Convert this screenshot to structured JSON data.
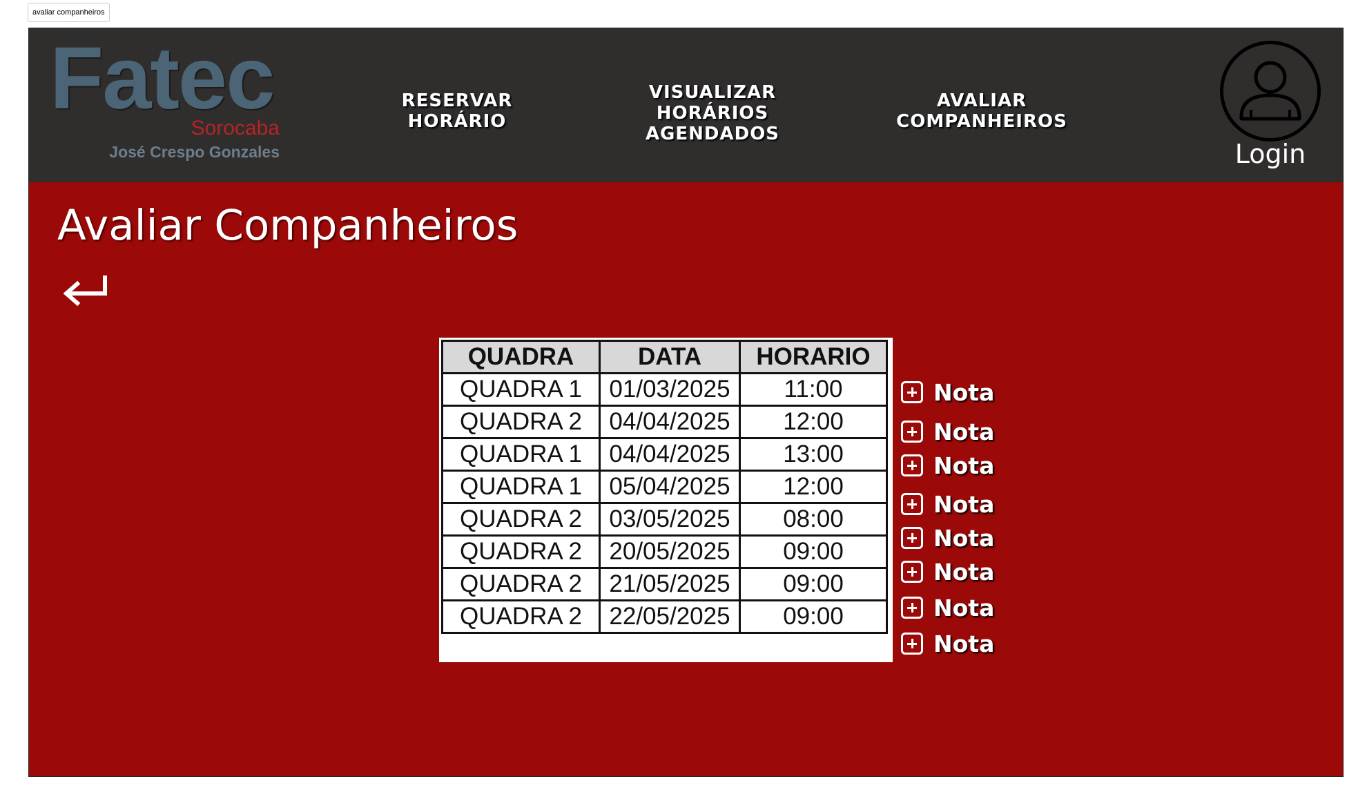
{
  "browser": {
    "tab_label": "avaliar companheiros"
  },
  "header": {
    "logo": {
      "main": "Fatec",
      "city": "Sorocaba",
      "subtitle": "José Crespo Gonzales"
    },
    "nav": [
      {
        "label": "RESERVAR\nHORÁRIO"
      },
      {
        "label": "VISUALIZAR\nHORÁRIOS\nAGENDADOS"
      },
      {
        "label": "AVALIAR\nCOMPANHEIROS"
      }
    ],
    "login": {
      "label": "Login",
      "icon": "user-icon"
    }
  },
  "main": {
    "title": "Avaliar Companheiros",
    "back_icon": "return-arrow-icon",
    "table": {
      "headers": [
        "QUADRA",
        "DATA",
        "HORARIO"
      ],
      "rows": [
        [
          "QUADRA 1",
          "01/03/2025",
          "11:00"
        ],
        [
          "QUADRA 2",
          "04/04/2025",
          "12:00"
        ],
        [
          "QUADRA 1",
          "04/04/2025",
          "13:00"
        ],
        [
          "QUADRA 1",
          "05/04/2025",
          "12:00"
        ],
        [
          "QUADRA 2",
          "03/05/2025",
          "08:00"
        ],
        [
          "QUADRA 2",
          "20/05/2025",
          "09:00"
        ],
        [
          "QUADRA 2",
          "21/05/2025",
          "09:00"
        ],
        [
          "QUADRA 2",
          "22/05/2025",
          "09:00"
        ]
      ]
    },
    "nota_buttons": [
      {
        "label": "Nota",
        "icon": "plus-square-icon"
      },
      {
        "label": "Nota",
        "icon": "plus-square-icon"
      },
      {
        "label": "Nota",
        "icon": "plus-square-icon"
      },
      {
        "label": "Nota",
        "icon": "plus-square-icon"
      },
      {
        "label": "Nota",
        "icon": "plus-square-icon"
      },
      {
        "label": "Nota",
        "icon": "plus-square-icon"
      },
      {
        "label": "Nota",
        "icon": "plus-square-icon"
      },
      {
        "label": "Nota",
        "icon": "plus-square-icon"
      }
    ]
  },
  "colors": {
    "header_bg": "#302d2d",
    "page_bg": "#9b0909",
    "logo_main": "#4b6476",
    "logo_city": "#b42525",
    "logo_subtitle": "#6c7f8c",
    "text_light": "#ffffff",
    "table_header_bg": "#d8d8d8"
  }
}
